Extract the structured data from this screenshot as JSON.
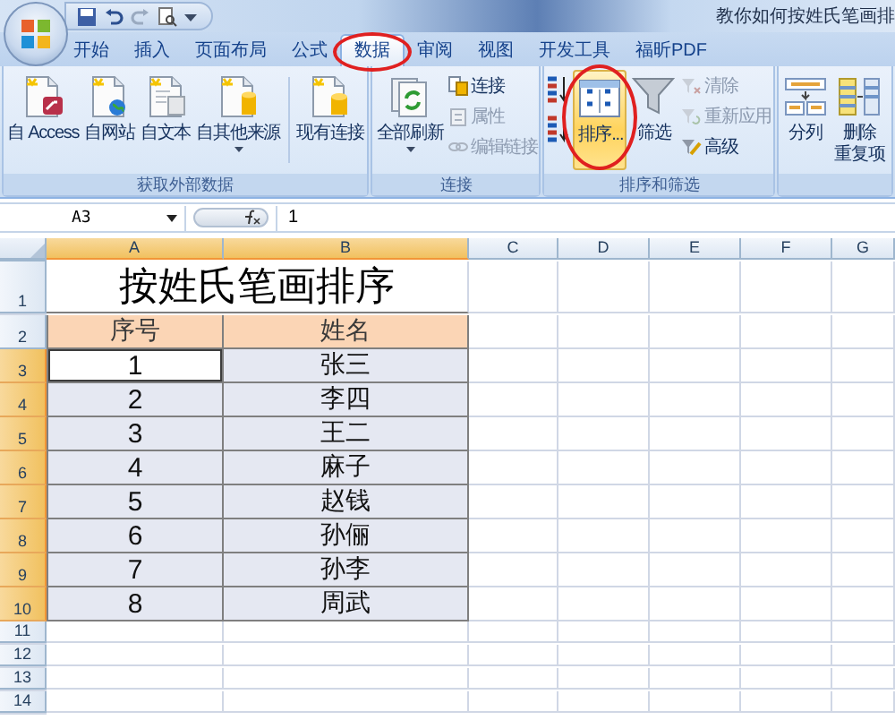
{
  "window": {
    "title": "教你如何按姓氏笔画排"
  },
  "tabs": [
    {
      "label": "开始",
      "selected": false,
      "circled": false
    },
    {
      "label": "插入",
      "selected": false,
      "circled": false
    },
    {
      "label": "页面布局",
      "selected": false,
      "circled": false
    },
    {
      "label": "公式",
      "selected": false,
      "circled": false
    },
    {
      "label": "数据",
      "selected": true,
      "circled": true
    },
    {
      "label": "审阅",
      "selected": false,
      "circled": false
    },
    {
      "label": "视图",
      "selected": false,
      "circled": false
    },
    {
      "label": "开发工具",
      "selected": false,
      "circled": false
    },
    {
      "label": "福昕PDF",
      "selected": false,
      "circled": false
    }
  ],
  "ribbon": {
    "groups": [
      {
        "label": "获取外部数据",
        "items": [
          {
            "kind": "large",
            "label": "自 Access",
            "dropdown": false,
            "highlighted": false,
            "circled": false
          },
          {
            "kind": "large",
            "label": "自网站",
            "dropdown": false,
            "highlighted": false,
            "circled": false
          },
          {
            "kind": "large",
            "label": "自文本",
            "dropdown": false,
            "highlighted": false,
            "circled": false
          },
          {
            "kind": "large",
            "label": "自其他来源",
            "dropdown": true,
            "highlighted": false,
            "circled": false
          },
          {
            "kind": "separator"
          },
          {
            "kind": "large",
            "label": "现有连接",
            "dropdown": false,
            "highlighted": false,
            "circled": false
          }
        ]
      },
      {
        "label": "连接",
        "items": [
          {
            "kind": "large",
            "label": "全部刷新",
            "dropdown": true,
            "highlighted": false,
            "circled": false
          },
          {
            "kind": "stack",
            "items": [
              {
                "label": "连接",
                "disabled": false
              },
              {
                "label": "属性",
                "disabled": true
              },
              {
                "label": "编辑链接",
                "disabled": true
              }
            ]
          }
        ]
      },
      {
        "label": "排序和筛选",
        "items": [
          {
            "kind": "sort_icons"
          },
          {
            "kind": "large",
            "label": "排序...",
            "dropdown": false,
            "highlighted": true,
            "circled": true
          },
          {
            "kind": "large",
            "label": "筛选",
            "dropdown": false,
            "highlighted": false,
            "circled": false
          },
          {
            "kind": "stack",
            "items": [
              {
                "label": "清除",
                "disabled": true
              },
              {
                "label": "重新应用",
                "disabled": true
              },
              {
                "label": "高级",
                "disabled": false
              }
            ]
          }
        ]
      },
      {
        "items": [
          {
            "kind": "large",
            "label": "分列",
            "dropdown": false,
            "highlighted": false,
            "circled": false
          },
          {
            "kind": "large",
            "lines": [
              "删除",
              "重复项"
            ],
            "dropdown": false,
            "highlighted": false,
            "circled": false
          }
        ]
      }
    ]
  },
  "formula_bar": {
    "name_box": "A3",
    "value": "1"
  },
  "sheet": {
    "columns": [
      {
        "label": "A",
        "selected": true
      },
      {
        "label": "B",
        "selected": true
      },
      {
        "label": "C",
        "selected": false
      },
      {
        "label": "D",
        "selected": false
      },
      {
        "label": "E",
        "selected": false
      },
      {
        "label": "F",
        "selected": false
      },
      {
        "label": "G",
        "selected": false
      }
    ],
    "rows": [
      {
        "label": "1",
        "selected": false,
        "kind": "title",
        "cells": [
          {
            "text": "按姓氏笔画排序"
          }
        ]
      },
      {
        "label": "2",
        "selected": false,
        "kind": "header",
        "cells": [
          {
            "text": "序号"
          },
          {
            "text": "姓名"
          }
        ]
      },
      {
        "label": "3",
        "selected": true,
        "kind": "data",
        "cells": [
          {
            "text": "1",
            "active": true
          },
          {
            "text": "张三",
            "active": false
          }
        ]
      },
      {
        "label": "4",
        "selected": true,
        "kind": "data",
        "cells": [
          {
            "text": "2",
            "active": false
          },
          {
            "text": "李四",
            "active": false
          }
        ]
      },
      {
        "label": "5",
        "selected": true,
        "kind": "data",
        "cells": [
          {
            "text": "3",
            "active": false
          },
          {
            "text": "王二",
            "active": false
          }
        ]
      },
      {
        "label": "6",
        "selected": true,
        "kind": "data",
        "cells": [
          {
            "text": "4",
            "active": false
          },
          {
            "text": "麻子",
            "active": false
          }
        ]
      },
      {
        "label": "7",
        "selected": true,
        "kind": "data",
        "cells": [
          {
            "text": "5",
            "active": false
          },
          {
            "text": "赵钱",
            "active": false
          }
        ]
      },
      {
        "label": "8",
        "selected": true,
        "kind": "data",
        "cells": [
          {
            "text": "6",
            "active": false
          },
          {
            "text": "孙俪",
            "active": false
          }
        ]
      },
      {
        "label": "9",
        "selected": true,
        "kind": "data",
        "cells": [
          {
            "text": "7",
            "active": false
          },
          {
            "text": "孙李",
            "active": false
          }
        ]
      },
      {
        "label": "10",
        "selected": true,
        "kind": "data",
        "cells": [
          {
            "text": "8",
            "active": false
          },
          {
            "text": "周武",
            "active": false
          }
        ]
      },
      {
        "label": "11",
        "selected": false,
        "kind": "empty"
      },
      {
        "label": "12",
        "selected": false,
        "kind": "empty"
      },
      {
        "label": "13",
        "selected": false,
        "kind": "empty"
      },
      {
        "label": "14",
        "selected": false,
        "kind": "empty"
      }
    ]
  }
}
